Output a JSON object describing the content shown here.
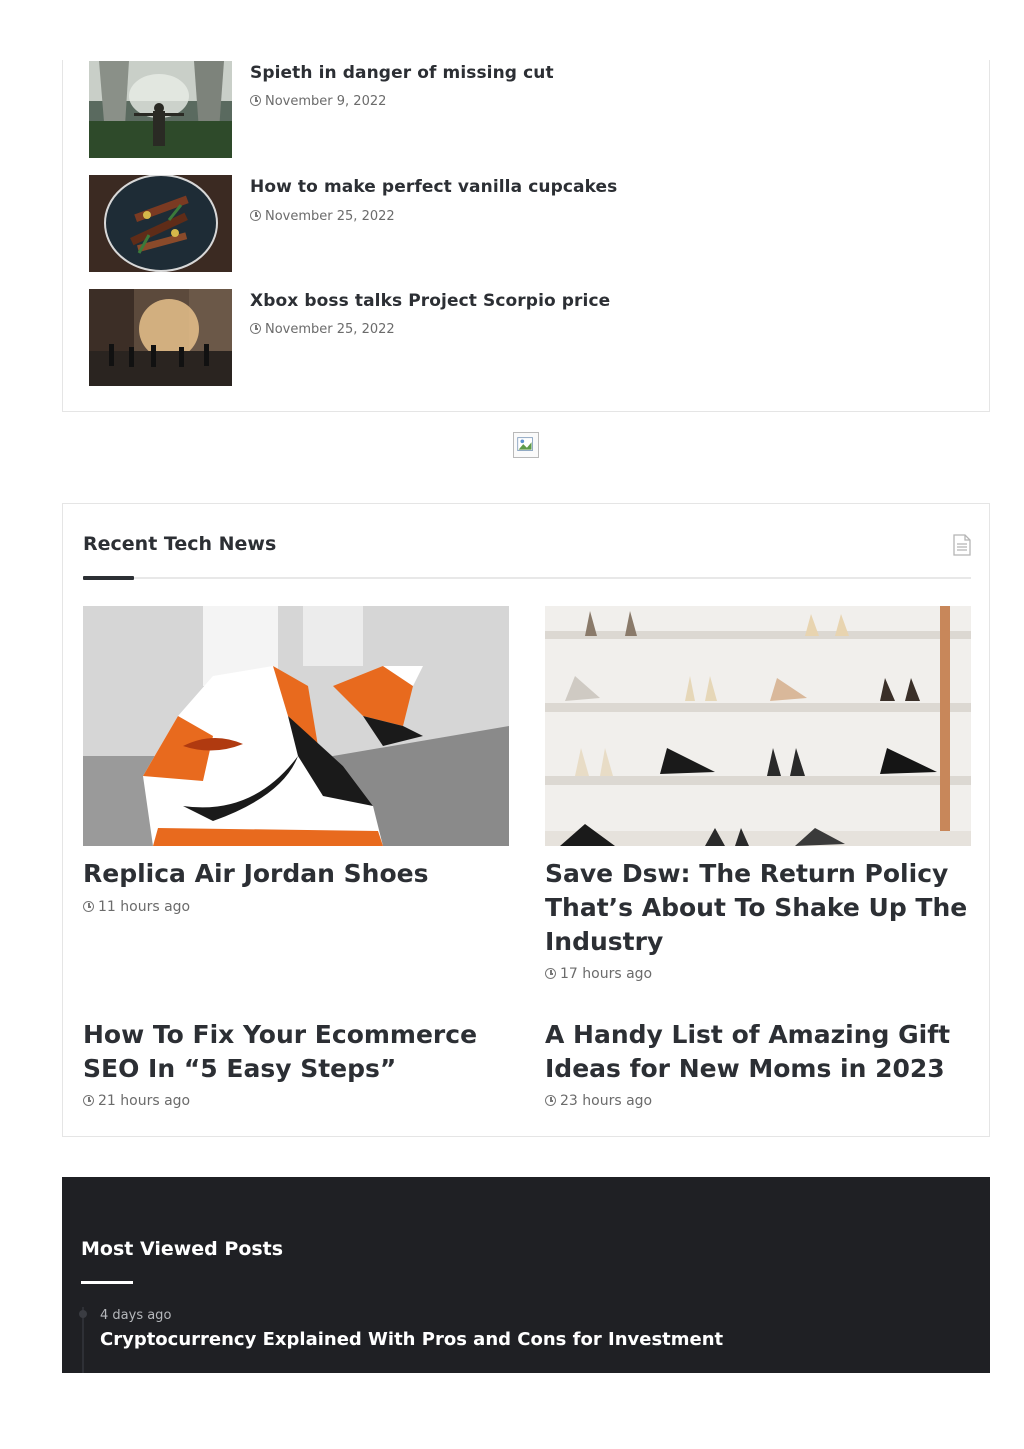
{
  "top_posts": [
    {
      "title": "Spieth in danger of missing cut",
      "date": "November 9, 2022"
    },
    {
      "title": "How to make perfect vanilla cupcakes",
      "date": "November 25, 2022"
    },
    {
      "title": "Xbox boss talks Project Scorpio price",
      "date": "November 25, 2022"
    }
  ],
  "recent_tech_news": {
    "heading": "Recent Tech News",
    "icon": "document-icon",
    "cards": [
      {
        "title": "Replica Air Jordan Shoes",
        "date": "11 hours ago"
      },
      {
        "title": "Save Dsw: The Return Policy That’s About To Shake Up The Industry",
        "date": "17 hours ago"
      },
      {
        "title": "How To Fix Your Ecommerce SEO In “5 Easy Steps”",
        "date": "21 hours ago"
      },
      {
        "title": "A Handy List of Amazing Gift Ideas for New Moms in 2023",
        "date": "23 hours ago"
      }
    ]
  },
  "most_viewed": {
    "heading": "Most Viewed Posts",
    "items": [
      {
        "date": "4 days ago",
        "title": "Cryptocurrency Explained With Pros and Cons for Investment"
      }
    ]
  },
  "colors": {
    "text": "#2c2f34",
    "meta": "#6b6b6b",
    "dark_section": "#1f2024",
    "border": "#e5e5e5"
  }
}
